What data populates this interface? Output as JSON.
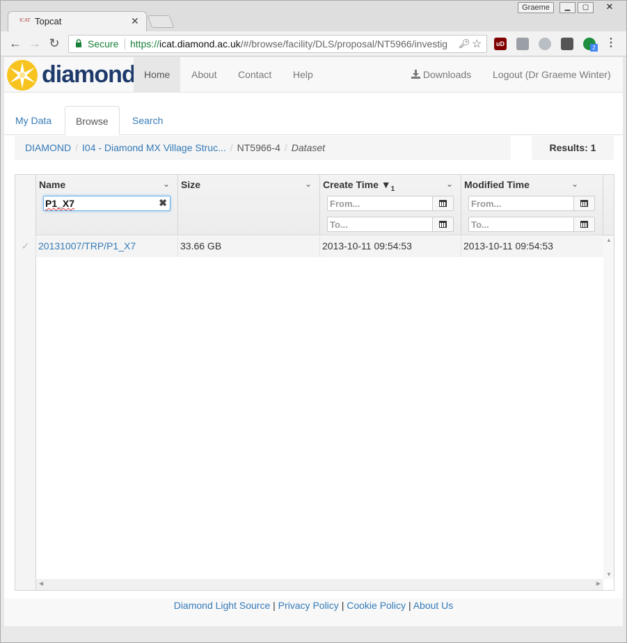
{
  "browser": {
    "tab_title": "Topcat",
    "favicon_text": "ICAT",
    "user_badge": "Graeme",
    "secure_label": "Secure",
    "url_protocol": "https://",
    "url_host": "icat.diamond.ac.uk",
    "url_path": "/#/browse/facility/DLS/proposal/NT5966/investig",
    "extension_badge_count": "2",
    "ublock_label": "uD"
  },
  "navbar": {
    "brand": "diamond",
    "items": [
      "Home",
      "About",
      "Contact",
      "Help"
    ],
    "active": "Home",
    "downloads": "Downloads",
    "logout": "Logout (Dr Graeme Winter)"
  },
  "tabs": [
    "My Data",
    "Browse",
    "Search"
  ],
  "breadcrumb": {
    "items": [
      "DIAMOND",
      "I04 - Diamond MX Village Struc...",
      "NT5966-4",
      "Dataset"
    ]
  },
  "results_label": "Results: 1",
  "grid": {
    "columns": {
      "name": "Name",
      "size": "Size",
      "create_time": "Create Time",
      "create_sort_index": "1",
      "modified_time": "Modified Time"
    },
    "name_filter_value": "P1_X7",
    "from_placeholder": "From...",
    "to_placeholder": "To...",
    "rows": [
      {
        "name": "20131007/TRP/P1_X7",
        "size": "33.66 GB",
        "create_time": "2013-10-11 09:54:53",
        "modified_time": "2013-10-11 09:54:53"
      }
    ]
  },
  "footer": {
    "links": [
      "Diamond Light Source",
      "Privacy Policy",
      "Cookie Policy",
      "About Us"
    ],
    "separator": "|"
  }
}
